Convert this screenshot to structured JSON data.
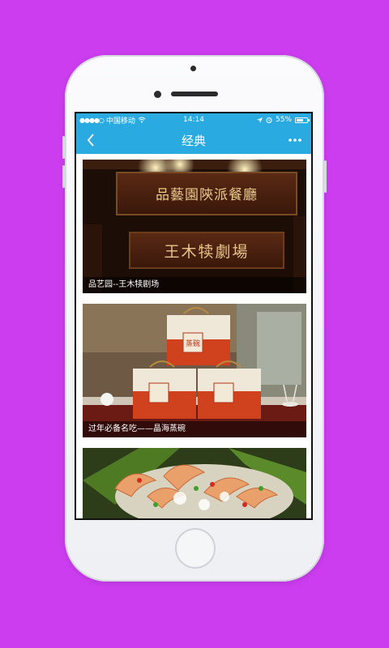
{
  "status_bar": {
    "carrier": "中国移动",
    "time": "14:14",
    "battery_percent": "55%"
  },
  "nav": {
    "title": "经典",
    "back_icon": "chevron-left-icon",
    "more_icon": "more-dots-icon"
  },
  "cards": [
    {
      "caption": "品艺园--王木犊剧场",
      "sign_top": "品藝園陝派餐廳",
      "sign_bottom": "王木犊劇場"
    },
    {
      "caption": "过年必备名吃——晶海蒸碗",
      "box_label": "蒸碗"
    },
    {
      "caption": ""
    }
  ],
  "colors": {
    "background": "#cc3df0",
    "nav_bar": "#29abe2"
  }
}
